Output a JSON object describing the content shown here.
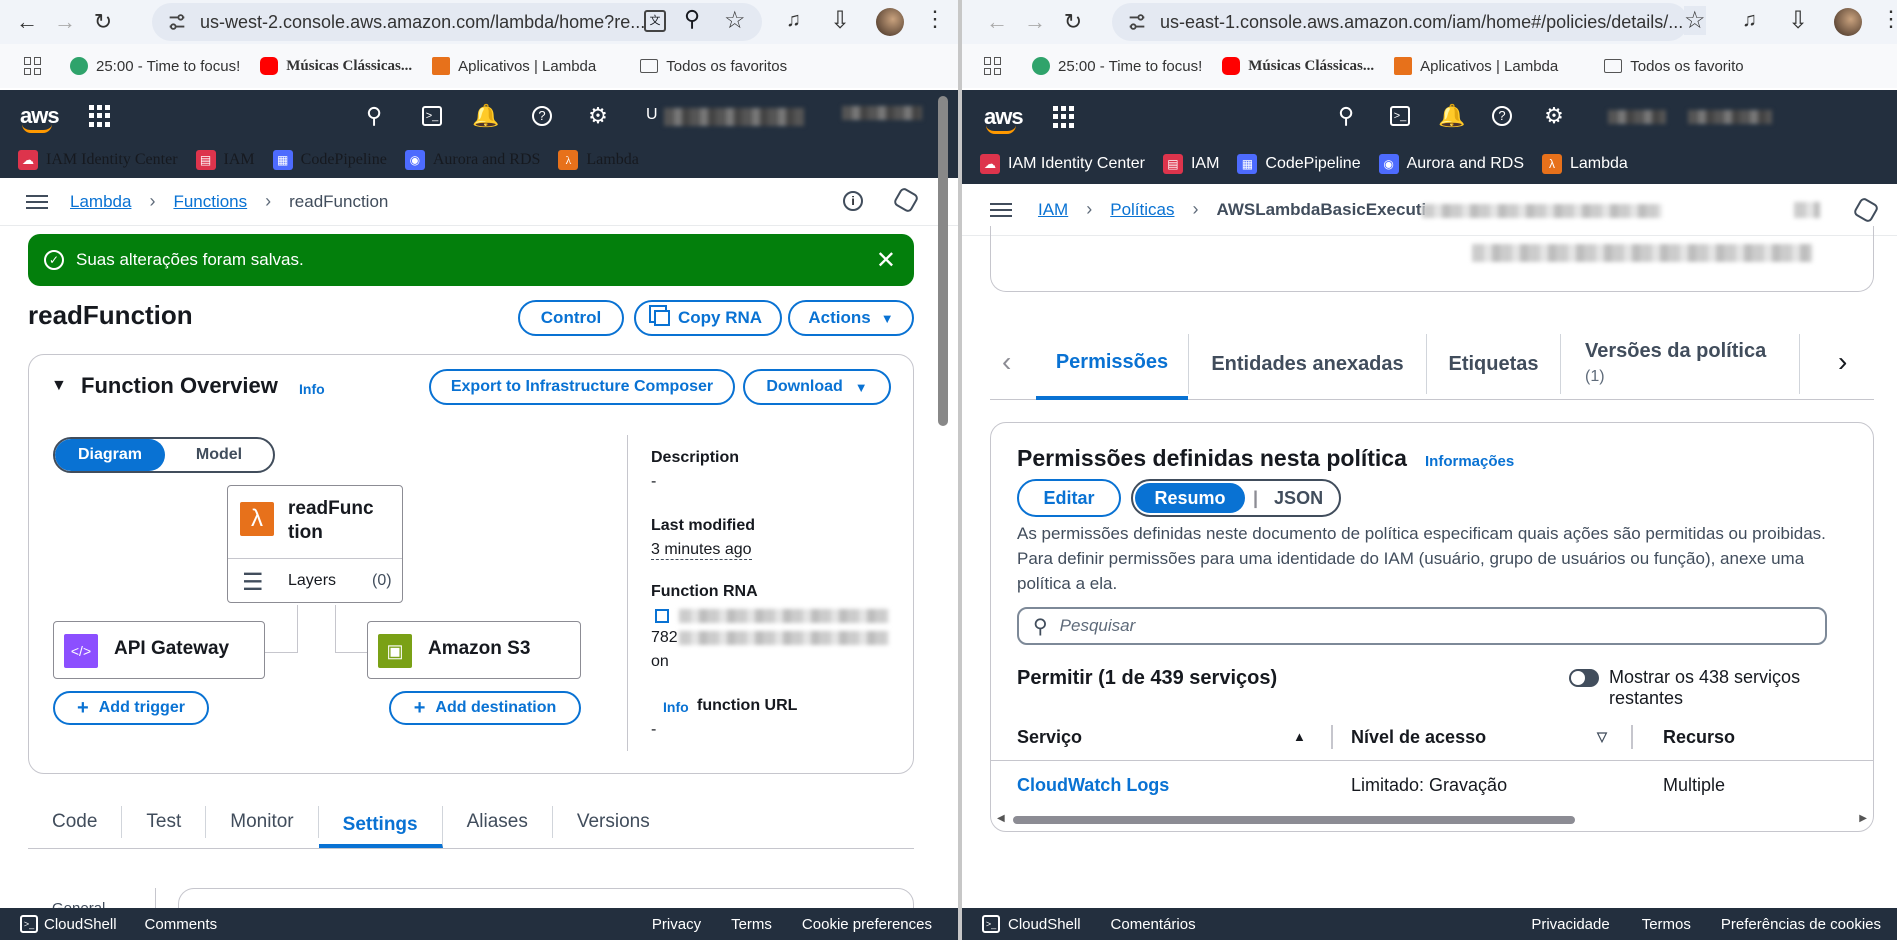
{
  "left": {
    "address": "us-west-2.console.aws.amazon.com/lambda/home?re...",
    "bookmarks": [
      "25:00 - Time to focus!",
      "Músicas Clássicas...",
      "Aplicativos | Lambda",
      "Todos os favoritos"
    ],
    "aws_top": {
      "account_initial": "U"
    },
    "favorites": [
      "IAM Identity Center",
      "IAM",
      "CodePipeline",
      "Aurora and RDS",
      "Lambda"
    ],
    "breadcrumb": {
      "root": "Lambda",
      "section": "Functions",
      "current": "readFunction"
    },
    "flash": "Suas alterações foram salvas.",
    "title": "readFunction",
    "buttons": {
      "control": "Control",
      "copy_rna": "Copy RNA",
      "actions": "Actions"
    },
    "overview": {
      "heading": "Function Overview",
      "info": "Info",
      "export": "Export to Infrastructure Composer",
      "download": "Download",
      "toggle": {
        "diagram": "Diagram",
        "model": "Model"
      },
      "node_name_l1": "readFunc",
      "node_name_l2": "tion",
      "layers_label": "Layers",
      "layers_count": "(0)",
      "trigger_name": "API Gateway",
      "destination_name": "Amazon S3",
      "add_trigger": "Add trigger",
      "add_destination": "Add destination",
      "description_label": "Description",
      "description_value": "-",
      "last_modified_label": "Last modified",
      "last_modified_value": "3 minutes ago",
      "rna_label": "Function RNA",
      "rna_prefix": "782",
      "rna_suffix": "on",
      "url_info": "Info",
      "url_label": "function URL",
      "url_value": "-"
    },
    "tabs": [
      "Code",
      "Test",
      "Monitor",
      "Settings",
      "Aliases",
      "Versions"
    ],
    "selected_tab": "Settings",
    "lower_left_label": "General",
    "footer": {
      "cloudshell": "CloudShell",
      "comments": "Comments",
      "privacy": "Privacy",
      "terms": "Terms",
      "cookies": "Cookie preferences"
    }
  },
  "right": {
    "address": "us-east-1.console.aws.amazon.com/iam/home#/policies/details/...",
    "bookmarks": [
      "25:00 - Time to focus!",
      "Músicas Clássicas...",
      "Aplicativos | Lambda",
      "Todos os favorito"
    ],
    "favorites": [
      "IAM Identity Center",
      "IAM",
      "CodePipeline",
      "Aurora and RDS",
      "Lambda"
    ],
    "breadcrumb": {
      "root": "IAM",
      "section": "Políticas",
      "current": "AWSLambdaBasicExecuti"
    },
    "tabs": {
      "permissions": "Permissões",
      "entities": "Entidades anexadas",
      "tags": "Etiquetas",
      "versions": "Versões da política",
      "versions_count": "(1)"
    },
    "permissions": {
      "heading": "Permissões definidas nesta política",
      "info": "Informações",
      "edit": "Editar",
      "summary": "Resumo",
      "json": "JSON",
      "description": "As permissões definidas neste documento de política especificam quais ações são permitidas ou proibidas. Para definir permissões para uma identidade do IAM (usuário, grupo de usuários ou função), anexe uma política a ela.",
      "search_placeholder": "Pesquisar",
      "allow_heading": "Permitir (1 de 439 serviços)",
      "show_remaining": "Mostrar os 438 serviços restantes",
      "columns": [
        "Serviço",
        "Nível de acesso",
        "Recurso"
      ],
      "rows": [
        {
          "service": "CloudWatch Logs",
          "access": "Limitado: Gravação",
          "resource": "Multiple"
        }
      ]
    },
    "footer": {
      "cloudshell": "CloudShell",
      "comments": "Comentários",
      "privacy": "Privacidade",
      "terms": "Termos",
      "cookies": "Preferências de cookies"
    }
  },
  "colors": {
    "aws_navy": "#232f3e",
    "link_blue": "#0972d3",
    "success_green": "#037f0c",
    "orange": "#ff9900"
  }
}
